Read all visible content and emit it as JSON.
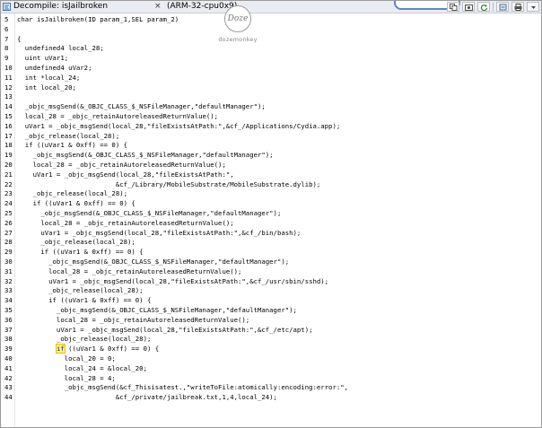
{
  "window": {
    "title": "Decompile: isJailbroken",
    "close_glyph": "×",
    "subtitle": "(ARM-32-cpu0x9)"
  },
  "toolbar": {
    "icons": [
      "copy-icon",
      "snapshot-icon",
      "refresh-icon",
      "export-icon",
      "print-icon",
      "menu-icon"
    ]
  },
  "watermark": {
    "logo_text": "Doze",
    "name": "dozemonkey"
  },
  "code": {
    "lines": [
      {
        "n": "5",
        "text": "char isJailbroken(ID param_1,SEL param_2)"
      },
      {
        "n": "6",
        "text": ""
      },
      {
        "n": "7",
        "text": "{"
      },
      {
        "n": "8",
        "text": "  undefined4 local_28;"
      },
      {
        "n": "9",
        "text": "  uint uVar1;"
      },
      {
        "n": "10",
        "text": "  undefined4 uVar2;"
      },
      {
        "n": "11",
        "text": "  int *local_24;"
      },
      {
        "n": "12",
        "text": "  int local_20;"
      },
      {
        "n": "13",
        "text": ""
      },
      {
        "n": "14",
        "text": "  _objc_msgSend(&_OBJC_CLASS_$_NSFileManager,\"defaultManager\");"
      },
      {
        "n": "15",
        "text": "  local_28 = _objc_retainAutoreleasedReturnValue();"
      },
      {
        "n": "16",
        "text": "  uVar1 = _objc_msgSend(local_28,\"fileExistsAtPath:\",&cf_/Applications/Cydia.app);"
      },
      {
        "n": "17",
        "text": "  _objc_release(local_28);"
      },
      {
        "n": "18",
        "text": "  if ((uVar1 & 0xff) == 0) {"
      },
      {
        "n": "19",
        "text": "    _objc_msgSend(&_OBJC_CLASS_$_NSFileManager,\"defaultManager\");"
      },
      {
        "n": "20",
        "text": "    local_28 = _objc_retainAutoreleasedReturnValue();"
      },
      {
        "n": "21",
        "text": "    uVar1 = _objc_msgSend(local_28,\"fileExistsAtPath:\","
      },
      {
        "n": "22",
        "text": "                         &cf_/Library/MobileSubstrate/MobileSubstrate.dylib);"
      },
      {
        "n": "23",
        "text": "    _objc_release(local_28);"
      },
      {
        "n": "24",
        "text": "    if ((uVar1 & 0xff) == 0) {"
      },
      {
        "n": "25",
        "text": "      _objc_msgSend(&_OBJC_CLASS_$_NSFileManager,\"defaultManager\");"
      },
      {
        "n": "26",
        "text": "      local_28 = _objc_retainAutoreleasedReturnValue();"
      },
      {
        "n": "27",
        "text": "      uVar1 = _objc_msgSend(local_28,\"fileExistsAtPath:\",&cf_/bin/bash);"
      },
      {
        "n": "28",
        "text": "      _objc_release(local_28);"
      },
      {
        "n": "29",
        "text": "      if ((uVar1 & 0xff) == 0) {"
      },
      {
        "n": "30",
        "text": "        _objc_msgSend(&_OBJC_CLASS_$_NSFileManager,\"defaultManager\");"
      },
      {
        "n": "31",
        "text": "        local_28 = _objc_retainAutoreleasedReturnValue();"
      },
      {
        "n": "32",
        "text": "        uVar1 = _objc_msgSend(local_28,\"fileExistsAtPath:\",&cf_/usr/sbin/sshd);"
      },
      {
        "n": "33",
        "text": "        _objc_release(local_28);"
      },
      {
        "n": "34",
        "text": "        if ((uVar1 & 0xff) == 0) {"
      },
      {
        "n": "35",
        "text": "          _objc_msgSend(&_OBJC_CLASS_$_NSFileManager,\"defaultManager\");"
      },
      {
        "n": "36",
        "text": "          local_28 = _objc_retainAutoreleasedReturnValue();"
      },
      {
        "n": "37",
        "text": "          uVar1 = _objc_msgSend(local_28,\"fileExistsAtPath:\",&cf_/etc/apt);"
      },
      {
        "n": "38",
        "text": "          _objc_release(local_28);"
      },
      {
        "n": "39",
        "text": "          if ((uVar1 & 0xff) == 0) {",
        "highlight": "if"
      },
      {
        "n": "40",
        "text": "            local_20 = 0;"
      },
      {
        "n": "41",
        "text": "            local_24 = &local_20;"
      },
      {
        "n": "42",
        "text": "            local_28 = 4;"
      },
      {
        "n": "43",
        "text": "            _objc_msgSend(&cf_Thisisatest.,\"writeToFile:atomically:encoding:error:\","
      },
      {
        "n": "44",
        "text": "                         &cf_/private/jailbreak.txt,1,4,local_24);"
      }
    ]
  }
}
